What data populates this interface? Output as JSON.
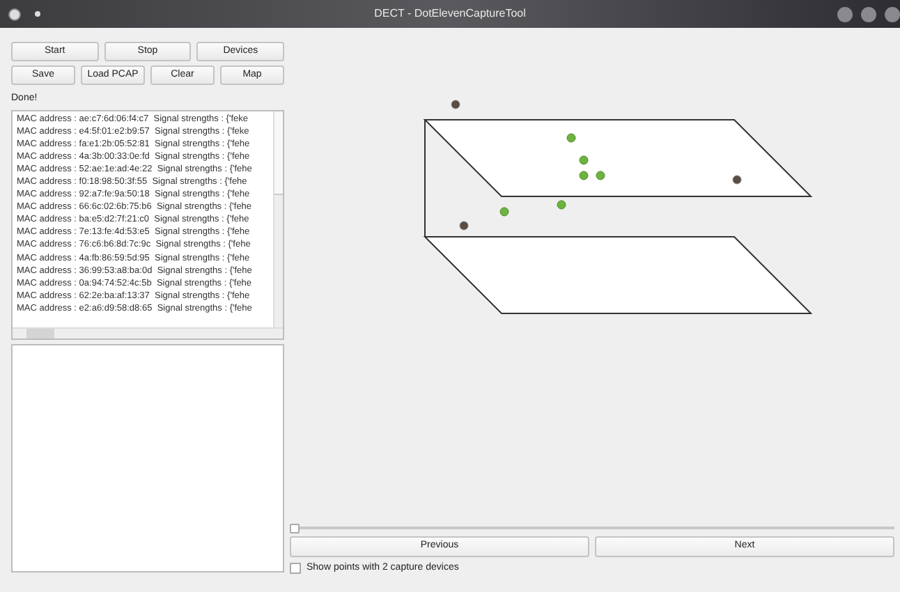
{
  "window": {
    "title": "DECT - DotElevenCaptureTool"
  },
  "button_rows": [
    [
      "Start",
      "Stop",
      "Devices"
    ],
    [
      "Save",
      "Load PCAP",
      "Clear",
      "Map"
    ]
  ],
  "status": "Done!",
  "capture_list": [
    "MAC address : ae:c7:6d:06:f4:c7  Signal strengths : {'feke",
    "MAC address : e4:5f:01:e2:b9:57  Signal strengths : {'feke",
    "MAC address : fa:e1:2b:05:52:81  Signal strengths : {'fehe",
    "MAC address : 4a:3b:00:33:0e:fd  Signal strengths : {'fehe",
    "MAC address : 52:ae:1e:ad:4e:22  Signal strengths : {'fehe",
    "MAC address : f0:18:98:50:3f:55  Signal strengths : {'fehe",
    "MAC address : 92:a7:fe:9a:50:18  Signal strengths : {'fehe",
    "MAC address : 66:6c:02:6b:75:b6  Signal strengths : {'fehe",
    "MAC address : ba:e5:d2:7f:21:c0  Signal strengths : {'fehe",
    "MAC address : 7e:13:fe:4d:53:e5  Signal strengths : {'fehe",
    "MAC address : 76:c6:b6:8d:7c:9c  Signal strengths : {'fehe",
    "MAC address : 4a:fb:86:59:5d:95  Signal strengths : {'fehe",
    "MAC address : 36:99:53:a8:ba:0d  Signal strengths : {'fehe",
    "MAC address : 0a:94:74:52:4c:5b  Signal strengths : {'fehe",
    "MAC address : 62:2e:ba:af:13:37  Signal strengths : {'fehe",
    "MAC address : e2:a6:d9:58:d8:65  Signal strengths : {'fehe"
  ],
  "slider": {
    "level": 0
  },
  "nav_buttons": [
    "Previous",
    "Next"
  ],
  "checkbox": {
    "label": "Show points with 2 capture devices",
    "checked": false
  }
}
